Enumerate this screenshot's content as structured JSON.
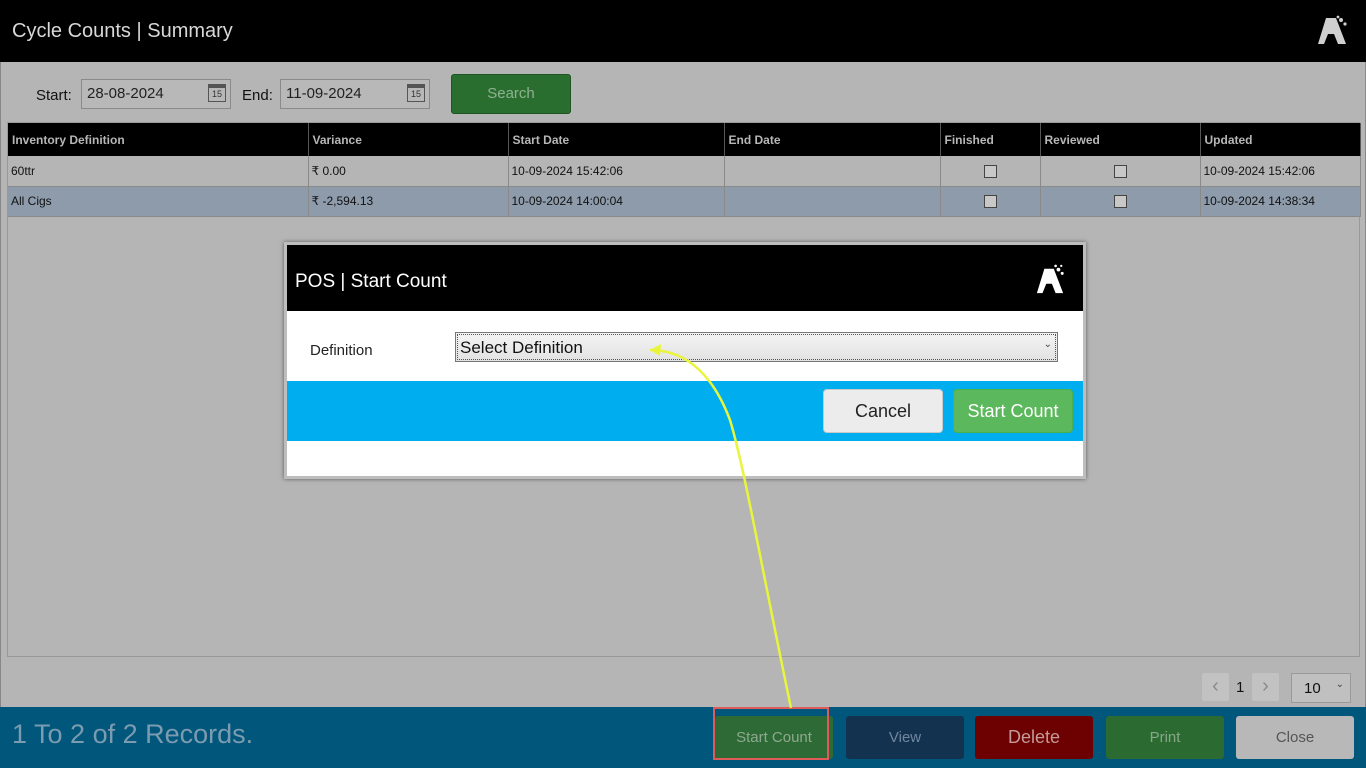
{
  "window": {
    "title": "Cycle Counts | Summary",
    "logo_icon": "app-logo-icon"
  },
  "filters": {
    "start_label": "Start:",
    "start_value": "28-08-2024",
    "end_label": "End:",
    "end_value": "11-09-2024",
    "calendar_day": "15",
    "search_label": "Search"
  },
  "table": {
    "columns": [
      "Inventory Definition",
      "Variance",
      "Start Date",
      "End Date",
      "Finished",
      "Reviewed",
      "Updated"
    ],
    "rows": [
      {
        "definition": "60ttr",
        "variance": "₹ 0.00",
        "start_date": "10-09-2024 15:42:06",
        "end_date": "",
        "finished": false,
        "reviewed": false,
        "updated": "10-09-2024 15:42:06"
      },
      {
        "definition": "All Cigs",
        "variance": "₹ -2,594.13",
        "start_date": "10-09-2024 14:00:04",
        "end_date": "",
        "finished": false,
        "reviewed": false,
        "updated": "10-09-2024 14:38:34"
      }
    ]
  },
  "pager": {
    "prev_icon": "‹",
    "page": "1",
    "next_icon": "›",
    "page_size": "10"
  },
  "footer": {
    "records_text": "1 To 2 of 2 Records.",
    "buttons": {
      "start_count": "Start Count",
      "view": "View",
      "delete": "Delete",
      "print": "Print",
      "close": "Close"
    }
  },
  "modal": {
    "title": "POS | Start Count",
    "definition_label": "Definition",
    "definition_value": "Select Definition",
    "cancel_label": "Cancel",
    "start_label": "Start Count"
  },
  "colors": {
    "accent_blue": "#00aeef",
    "footer_blue": "#00567b",
    "start_green": "#5cb85c",
    "delete_red": "#6d0000",
    "annotation_arrow": "#e8f53a",
    "highlight_box": "#e05a5a"
  }
}
